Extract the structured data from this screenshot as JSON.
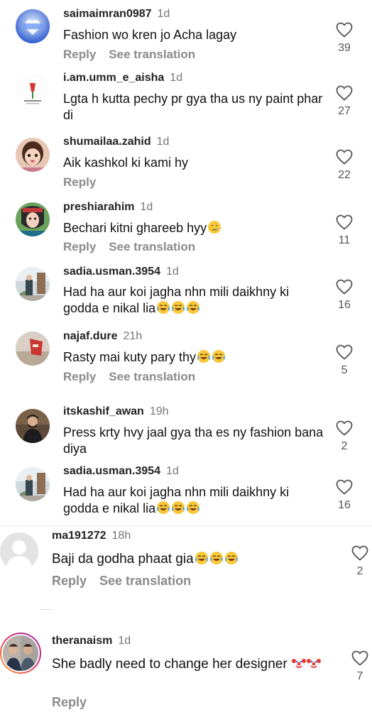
{
  "icons": {
    "like": "heart-outline-icon",
    "laugh": "face-with-tears-of-joy-emoji",
    "sad": "crying-face-emoji",
    "clown": "clown-face-emoji"
  },
  "comments": [
    {
      "username": "saimaimran0987",
      "time": "1d",
      "text": "Fashion wo kren jo Acha lagay",
      "emoji": "",
      "reply": "Reply",
      "translate": "See translation",
      "likes": "39"
    },
    {
      "username": "i.am.umm_e_aisha",
      "time": "1d",
      "text": "Lgta h kutta pechy pr gya tha us ny paint phar di",
      "emoji": "",
      "reply": "",
      "translate": "",
      "likes": "27"
    },
    {
      "username": "shumailaa.zahid",
      "time": "1d",
      "text": "Aik kashkol ki kami hy",
      "emoji": "",
      "reply": "Reply",
      "translate": "",
      "likes": "22"
    },
    {
      "username": "preshiarahim",
      "time": "1d",
      "text": "Bechari kitni ghareeb hyy",
      "emoji": "sad",
      "reply": "Reply",
      "translate": "See translation",
      "likes": "11"
    },
    {
      "username": "sadia.usman.3954",
      "time": "1d",
      "text": "Had ha aur koi jagha nhn mili daikhny ki godda e nikal lia",
      "emoji": "laugh3",
      "reply": "",
      "translate": "",
      "likes": "16"
    },
    {
      "username": "najaf.dure",
      "time": "21h",
      "text": "Rasty mai kuty pary thy",
      "emoji": "laugh2",
      "reply": "Reply",
      "translate": "See translation",
      "likes": "5"
    },
    {
      "username": "itskashif_awan",
      "time": "19h",
      "text": "Press krty hvy jaal gya tha es ny fashion bana diya",
      "emoji": "",
      "reply": "",
      "translate": "",
      "likes": "2"
    },
    {
      "username": "sadia.usman.3954",
      "time": "1d",
      "text": "Had ha aur koi jagha nhn mili daikhny ki godda e nikal lia",
      "emoji": "laugh3",
      "reply": "",
      "translate": "",
      "likes": "16"
    },
    {
      "username": "ma191272",
      "time": "18h",
      "text": "Baji da godha  phaat gia",
      "emoji": "laugh3",
      "reply": "Reply",
      "translate": "See translation",
      "likes": "2"
    },
    {
      "username": "theranaism",
      "time": "1d",
      "text": "She badly need to change her designer",
      "emoji": "clown2",
      "reply": "Reply",
      "translate": "",
      "likes": "7"
    }
  ]
}
